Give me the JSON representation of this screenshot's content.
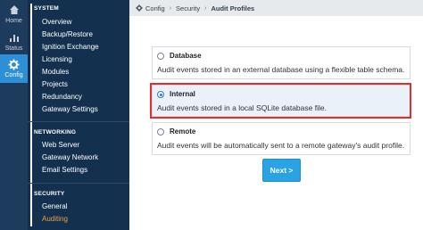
{
  "rail": [
    {
      "label": "Home",
      "icon": "home-icon"
    },
    {
      "label": "Status",
      "icon": "status-icon"
    },
    {
      "label": "Config",
      "icon": "gear-icon"
    }
  ],
  "nav": {
    "sections": [
      {
        "heading": "SYSTEM",
        "items": [
          "Overview",
          "Backup/Restore",
          "Ignition Exchange",
          "Licensing",
          "Modules",
          "Projects",
          "Redundancy",
          "Gateway Settings"
        ]
      },
      {
        "heading": "NETWORKING",
        "items": [
          "Web Server",
          "Gateway Network",
          "Email Settings"
        ]
      },
      {
        "heading": "SECURITY",
        "items": [
          "General",
          "Auditing"
        ]
      }
    ]
  },
  "breadcrumb": {
    "items": [
      "Config",
      "Security",
      "Audit Profiles"
    ],
    "icon": "gear-icon"
  },
  "options": [
    {
      "title": "Database",
      "desc": "Audit events stored in an external database using a flexible table schema.",
      "selected": false
    },
    {
      "title": "Internal",
      "desc": "Audit events stored in a local SQLite database file.",
      "selected": true
    },
    {
      "title": "Remote",
      "desc": "Audit events will be automatically sent to a remote gateway's audit profile.",
      "selected": false
    }
  ],
  "next_label": "Next >",
  "colors": {
    "accent": "#2d8fd5",
    "highlight": "#e0302b",
    "active_nav": "#f0a03c",
    "nav_bg": "#13314f"
  }
}
